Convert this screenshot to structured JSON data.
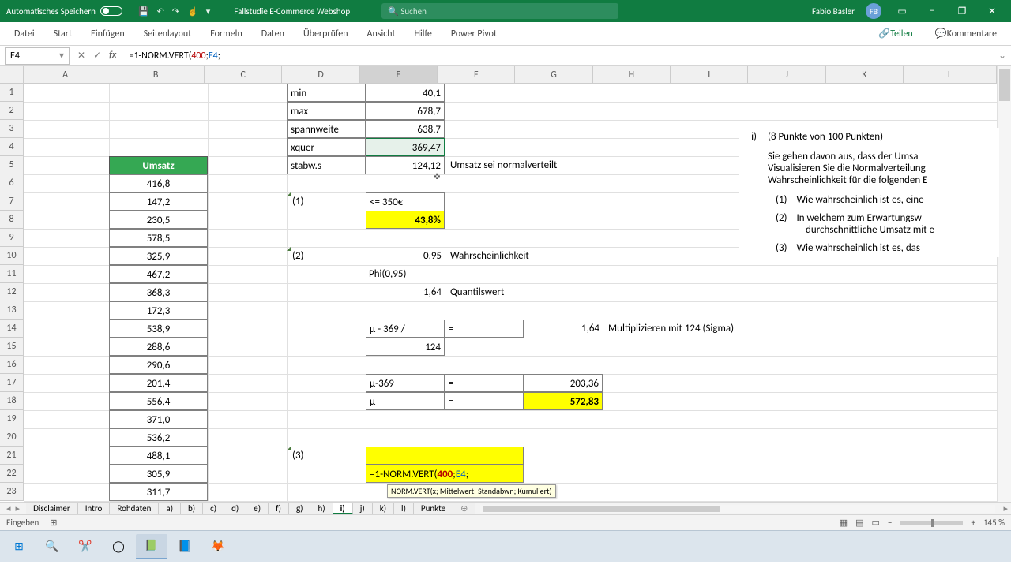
{
  "title": {
    "autosave": "Automatisches Speichern",
    "doc": "Fallstudie E-Commerce Webshop",
    "search_ph": "Suchen",
    "user": "Fabio Basler",
    "initials": "FB"
  },
  "ribbon": {
    "tabs": [
      "Datei",
      "Start",
      "Einfügen",
      "Seitenlayout",
      "Formeln",
      "Daten",
      "Überprüfen",
      "Ansicht",
      "Hilfe",
      "Power Pivot"
    ],
    "share": "Teilen",
    "comments": "Kommentare"
  },
  "fbar": {
    "namebox": "E4",
    "formula_prefix": "=1-NORM.VERT(",
    "formula_arg1": "400",
    "formula_sep": ";",
    "formula_arg2": "E4",
    "formula_end": ";"
  },
  "cols": [
    "A",
    "B",
    "C",
    "D",
    "E",
    "F",
    "G",
    "H",
    "I",
    "J",
    "K",
    "L"
  ],
  "stats": {
    "min_l": "min",
    "min_v": "40,1",
    "max_l": "max",
    "max_v": "678,7",
    "span_l": "spannweite",
    "span_v": "638,7",
    "xq_l": "xquer",
    "xq_v": "369,47",
    "sd_l": "stabw.s",
    "sd_v": "124,12",
    "f5": "Umsatz sei normalverteilt"
  },
  "umsatz": {
    "header": "Umsatz",
    "values": [
      "416,8",
      "147,2",
      "230,5",
      "578,5",
      "325,9",
      "467,2",
      "368,3",
      "172,3",
      "538,9",
      "288,6",
      "290,6",
      "201,4",
      "556,4",
      "371,0",
      "536,2",
      "488,1",
      "305,9",
      "311,7"
    ]
  },
  "q1": {
    "label": "(1)",
    "e7": "<= 350€",
    "e8": "43,8%"
  },
  "q2": {
    "label": "(2)",
    "e10": "0,95",
    "f10": "Wahrscheinlichkeit",
    "e11": "Phi(0,95)",
    "e12": "1,64",
    "f12": "Quantilswert",
    "e14": "µ - 369 /",
    "f14": "=",
    "g14": "1,64",
    "h14": "Multiplizieren mit 124 (Sigma)",
    "e15": "124",
    "e17": "µ-369",
    "f17": "=",
    "g17": "203,36",
    "e18": "µ",
    "f18": "=",
    "g18": "572,83"
  },
  "q3": {
    "label": "(3)",
    "edit": "=1-NORM.VERT(400;E4;",
    "tip": "NORM.VERT(x; Mittelwert; Standabwn; Kumuliert)"
  },
  "notes": {
    "i": "i)",
    "head": "(8 Punkte von 100 Punkten)",
    "l1": "Sie gehen davon aus, dass der Umsa",
    "l2": "Visualisieren Sie die Normalverteilung",
    "l3": "Wahrscheinlichkeit für die folgenden E",
    "li1n": "(1)",
    "li1": "Wie wahrscheinlich ist es, eine",
    "li2n": "(2)",
    "li2a": "In welchem zum Erwartungsw",
    "li2b": "durchschnittliche Umsatz mit e",
    "li3n": "(3)",
    "li3": "Wie wahrscheinlich ist es, das"
  },
  "sheettabs": [
    "Disclaimer",
    "Intro",
    "Rohdaten",
    "a)",
    "b)",
    "c)",
    "d)",
    "e)",
    "f)",
    "g)",
    "h)",
    "i)",
    "j)",
    "k)",
    "l)",
    "Punkte"
  ],
  "status": {
    "mode": "Eingeben",
    "zoom": "145 %"
  }
}
